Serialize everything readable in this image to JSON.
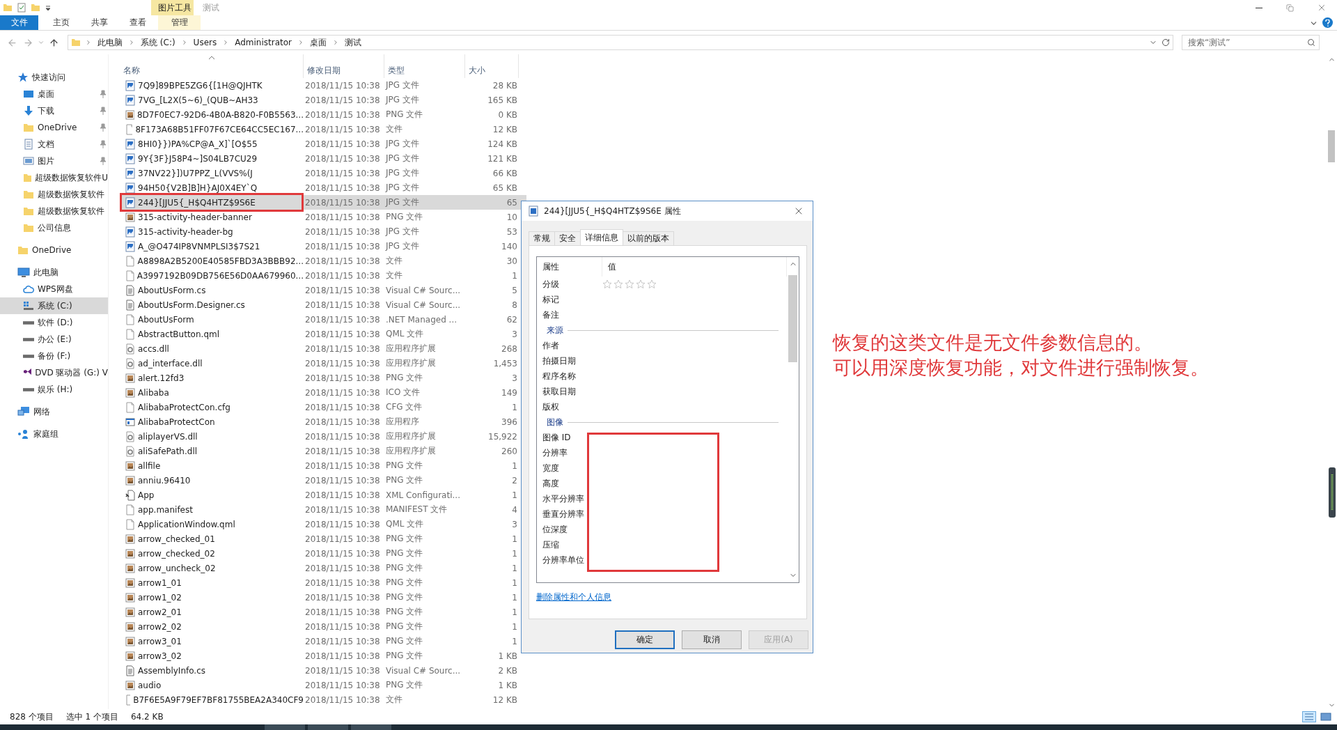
{
  "window": {
    "title": "测试",
    "context_header": "图片工具"
  },
  "ribbon_tabs": [
    {
      "label": "文件",
      "kind": "file"
    },
    {
      "label": "主页",
      "kind": "tab"
    },
    {
      "label": "共享",
      "kind": "tab"
    },
    {
      "label": "查看",
      "kind": "tab"
    },
    {
      "label": "管理",
      "kind": "context"
    }
  ],
  "address": {
    "crumbs": [
      "此电脑",
      "系统 (C:)",
      "Users",
      "Administrator",
      "桌面",
      "测试"
    ]
  },
  "search": {
    "placeholder": "搜索“测试”"
  },
  "sidebar": {
    "items": [
      {
        "label": "快速访问",
        "kind": "star",
        "selected": false,
        "pinned": false,
        "children": [
          {
            "label": "桌面",
            "kind": "desktop",
            "selected": false,
            "pinned": true
          },
          {
            "label": "下载",
            "kind": "download",
            "selected": false,
            "pinned": true
          },
          {
            "label": "OneDrive",
            "kind": "folder",
            "selected": false,
            "pinned": true
          },
          {
            "label": "文档",
            "kind": "document",
            "selected": false,
            "pinned": true
          },
          {
            "label": "图片",
            "kind": "picture",
            "selected": false,
            "pinned": true
          },
          {
            "label": "超级数据恢复软件U",
            "kind": "folder",
            "selected": false,
            "pinned": false
          },
          {
            "label": "超级数据恢复软件",
            "kind": "folder",
            "selected": false,
            "pinned": false
          },
          {
            "label": "超级数据恢复软件",
            "kind": "folder",
            "selected": false,
            "pinned": false
          },
          {
            "label": "公司信息",
            "kind": "folder",
            "selected": false,
            "pinned": false
          }
        ]
      },
      {
        "label": "OneDrive",
        "kind": "folder",
        "selected": false,
        "pinned": false
      },
      {
        "label": "此电脑",
        "kind": "pc",
        "selected": false,
        "pinned": false,
        "children": [
          {
            "label": "WPS网盘",
            "kind": "cloud",
            "selected": false,
            "pinned": false
          },
          {
            "label": "系统 (C:)",
            "kind": "sysdrive",
            "selected": true,
            "pinned": false
          },
          {
            "label": "软件 (D:)",
            "kind": "drive",
            "selected": false,
            "pinned": false
          },
          {
            "label": "办公 (E:)",
            "kind": "drive",
            "selected": false,
            "pinned": false
          },
          {
            "label": "备份 (F:)",
            "kind": "drive",
            "selected": false,
            "pinned": false
          },
          {
            "label": "DVD 驱动器 (G:) V",
            "kind": "dvd",
            "selected": false,
            "pinned": false
          },
          {
            "label": "娱乐 (H:)",
            "kind": "drive",
            "selected": false,
            "pinned": false
          }
        ]
      },
      {
        "label": "网络",
        "kind": "network",
        "selected": false,
        "pinned": false
      },
      {
        "label": "家庭组",
        "kind": "homegroup",
        "selected": false,
        "pinned": false
      }
    ]
  },
  "file_list": {
    "columns": [
      {
        "label": "名称",
        "sorted": true
      },
      {
        "label": "修改日期",
        "sorted": false
      },
      {
        "label": "类型",
        "sorted": false
      },
      {
        "label": "大小",
        "sorted": false
      }
    ],
    "rows": [
      {
        "name": "7Q9]89BPE5ZG6{[1H@QJHTK",
        "date": "2018/11/15 10:38",
        "type": "JPG 文件",
        "size": "28 KB",
        "kind": "jpg",
        "selected": false
      },
      {
        "name": "7VG_[L2X(5~6)_(QUB~AH33",
        "date": "2018/11/15 10:38",
        "type": "JPG 文件",
        "size": "165 KB",
        "kind": "jpg",
        "selected": false
      },
      {
        "name": "8D7F0EC7-92D6-4B0A-B820-F0B5563...",
        "date": "2018/11/15 10:38",
        "type": "PNG 文件",
        "size": "0 KB",
        "kind": "png",
        "selected": false
      },
      {
        "name": "8F173A68B51FF07F67CE64CC5EC167...",
        "date": "2018/11/15 10:38",
        "type": "文件",
        "size": "12 KB",
        "kind": "file",
        "selected": false
      },
      {
        "name": "8HI0}})PA%CP@A_X]`[O$55",
        "date": "2018/11/15 10:38",
        "type": "JPG 文件",
        "size": "124 KB",
        "kind": "jpg",
        "selected": false
      },
      {
        "name": "9Y{3F}J58P4~]S04LB7CU29",
        "date": "2018/11/15 10:38",
        "type": "JPG 文件",
        "size": "121 KB",
        "kind": "jpg",
        "selected": false
      },
      {
        "name": "37NV22}])U7PPZ_L(VVS%(J",
        "date": "2018/11/15 10:38",
        "type": "JPG 文件",
        "size": "66 KB",
        "kind": "jpg",
        "selected": false
      },
      {
        "name": "94H50{V2B]B]H}AJ0X4EY`Q",
        "date": "2018/11/15 10:38",
        "type": "JPG 文件",
        "size": "65 KB",
        "kind": "jpg",
        "selected": false
      },
      {
        "name": "244}[JJU5{_H$Q4HTZ$9S6E",
        "date": "2018/11/15 10:38",
        "type": "JPG 文件",
        "size": "65",
        "kind": "jpg",
        "selected": true
      },
      {
        "name": "315-activity-header-banner",
        "date": "2018/11/15 10:38",
        "type": "PNG 文件",
        "size": "10",
        "kind": "png",
        "selected": false
      },
      {
        "name": "315-activity-header-bg",
        "date": "2018/11/15 10:38",
        "type": "JPG 文件",
        "size": "53",
        "kind": "jpg",
        "selected": false
      },
      {
        "name": "A_@O474IP8VNMPLSI3$7S21",
        "date": "2018/11/15 10:38",
        "type": "JPG 文件",
        "size": "140",
        "kind": "jpg",
        "selected": false
      },
      {
        "name": "A8898A2B5200E40585FBD3A3BBB92...",
        "date": "2018/11/15 10:38",
        "type": "文件",
        "size": "30",
        "kind": "file",
        "selected": false
      },
      {
        "name": "A3997192B09DB756E56D0AA679960...",
        "date": "2018/11/15 10:38",
        "type": "文件",
        "size": "1",
        "kind": "file",
        "selected": false
      },
      {
        "name": "AboutUsForm.cs",
        "date": "2018/11/15 10:38",
        "type": "Visual C# Sourc...",
        "size": "5",
        "kind": "code",
        "selected": false
      },
      {
        "name": "AboutUsForm.Designer.cs",
        "date": "2018/11/15 10:38",
        "type": "Visual C# Sourc...",
        "size": "8",
        "kind": "code",
        "selected": false
      },
      {
        "name": "AboutUsForm",
        "date": "2018/11/15 10:38",
        "type": ".NET Managed ...",
        "size": "62",
        "kind": "file",
        "selected": false
      },
      {
        "name": "AbstractButton.qml",
        "date": "2018/11/15 10:38",
        "type": "QML 文件",
        "size": "3",
        "kind": "file",
        "selected": false
      },
      {
        "name": "accs.dll",
        "date": "2018/11/15 10:38",
        "type": "应用程序扩展",
        "size": "268",
        "kind": "dll",
        "selected": false
      },
      {
        "name": "ad_interface.dll",
        "date": "2018/11/15 10:38",
        "type": "应用程序扩展",
        "size": "1,453",
        "kind": "dll",
        "selected": false
      },
      {
        "name": "alert.12fd3",
        "date": "2018/11/15 10:38",
        "type": "PNG 文件",
        "size": "3",
        "kind": "png",
        "selected": false
      },
      {
        "name": "Alibaba",
        "date": "2018/11/15 10:38",
        "type": "ICO 文件",
        "size": "149",
        "kind": "png",
        "selected": false
      },
      {
        "name": "AlibabaProtectCon.cfg",
        "date": "2018/11/15 10:38",
        "type": "CFG 文件",
        "size": "1",
        "kind": "file",
        "selected": false
      },
      {
        "name": "AlibabaProtectCon",
        "date": "2018/11/15 10:38",
        "type": "应用程序",
        "size": "396",
        "kind": "exe",
        "selected": false
      },
      {
        "name": "aliplayerVS.dll",
        "date": "2018/11/15 10:38",
        "type": "应用程序扩展",
        "size": "15,922",
        "kind": "dll",
        "selected": false
      },
      {
        "name": "aliSafePath.dll",
        "date": "2018/11/15 10:38",
        "type": "应用程序扩展",
        "size": "260",
        "kind": "dll",
        "selected": false
      },
      {
        "name": "allfile",
        "date": "2018/11/15 10:38",
        "type": "PNG 文件",
        "size": "1",
        "kind": "png",
        "selected": false
      },
      {
        "name": "anniu.96410",
        "date": "2018/11/15 10:38",
        "type": "PNG 文件",
        "size": "2",
        "kind": "png",
        "selected": false
      },
      {
        "name": "App",
        "date": "2018/11/15 10:38",
        "type": "XML Configurati...",
        "size": "1",
        "kind": "xml",
        "selected": false
      },
      {
        "name": "app.manifest",
        "date": "2018/11/15 10:38",
        "type": "MANIFEST 文件",
        "size": "4",
        "kind": "file",
        "selected": false
      },
      {
        "name": "ApplicationWindow.qml",
        "date": "2018/11/15 10:38",
        "type": "QML 文件",
        "size": "3",
        "kind": "file",
        "selected": false
      },
      {
        "name": "arrow_checked_01",
        "date": "2018/11/15 10:38",
        "type": "PNG 文件",
        "size": "1",
        "kind": "png",
        "selected": false
      },
      {
        "name": "arrow_checked_02",
        "date": "2018/11/15 10:38",
        "type": "PNG 文件",
        "size": "1",
        "kind": "png",
        "selected": false
      },
      {
        "name": "arrow_uncheck_02",
        "date": "2018/11/15 10:38",
        "type": "PNG 文件",
        "size": "1",
        "kind": "png",
        "selected": false
      },
      {
        "name": "arrow1_01",
        "date": "2018/11/15 10:38",
        "type": "PNG 文件",
        "size": "1",
        "kind": "png",
        "selected": false
      },
      {
        "name": "arrow1_02",
        "date": "2018/11/15 10:38",
        "type": "PNG 文件",
        "size": "1",
        "kind": "png",
        "selected": false
      },
      {
        "name": "arrow2_01",
        "date": "2018/11/15 10:38",
        "type": "PNG 文件",
        "size": "1",
        "kind": "png",
        "selected": false
      },
      {
        "name": "arrow2_02",
        "date": "2018/11/15 10:38",
        "type": "PNG 文件",
        "size": "1",
        "kind": "png",
        "selected": false
      },
      {
        "name": "arrow3_01",
        "date": "2018/11/15 10:38",
        "type": "PNG 文件",
        "size": "1",
        "kind": "png",
        "selected": false
      },
      {
        "name": "arrow3_02",
        "date": "2018/11/15 10:38",
        "type": "PNG 文件",
        "size": "1 KB",
        "kind": "png",
        "selected": false
      },
      {
        "name": "AssemblyInfo.cs",
        "date": "2018/11/15 10:38",
        "type": "Visual C# Sourc...",
        "size": "2 KB",
        "kind": "code",
        "selected": false
      },
      {
        "name": "audio",
        "date": "2018/11/15 10:38",
        "type": "PNG 文件",
        "size": "1 KB",
        "kind": "png",
        "selected": false
      },
      {
        "name": "B7F6E5A9F79EF7BF81755BEA2A340CF9",
        "date": "2018/11/15 10:38",
        "type": "文件",
        "size": "12 KB",
        "kind": "file",
        "selected": false
      }
    ]
  },
  "annotation": {
    "lines": [
      "恢复的这类文件是无文件参数信息的。",
      "可以用深度恢复功能，对文件进行强制恢复。"
    ]
  },
  "dialog": {
    "title": "244}[JJU5{_H$Q4HTZ$9S6E 属性",
    "tabs": [
      {
        "label": "常规",
        "selected": false
      },
      {
        "label": "安全",
        "selected": false
      },
      {
        "label": "详细信息",
        "selected": true
      },
      {
        "label": "以前的版本",
        "selected": false
      }
    ],
    "columns": [
      "属性",
      "值"
    ],
    "properties": [
      {
        "kind": "rating",
        "label": "分级",
        "stars": 0
      },
      {
        "kind": "property",
        "label": "标记"
      },
      {
        "kind": "property",
        "label": "备注"
      },
      {
        "kind": "group",
        "label": "来源"
      },
      {
        "kind": "property",
        "label": "作者"
      },
      {
        "kind": "property",
        "label": "拍摄日期"
      },
      {
        "kind": "property",
        "label": "程序名称"
      },
      {
        "kind": "property",
        "label": "获取日期"
      },
      {
        "kind": "property",
        "label": "版权"
      },
      {
        "kind": "group",
        "label": "图像"
      },
      {
        "kind": "property",
        "label": "图像 ID"
      },
      {
        "kind": "property",
        "label": "分辨率"
      },
      {
        "kind": "property",
        "label": "宽度"
      },
      {
        "kind": "property",
        "label": "高度"
      },
      {
        "kind": "property",
        "label": "水平分辨率"
      },
      {
        "kind": "property",
        "label": "垂直分辨率"
      },
      {
        "kind": "property",
        "label": "位深度"
      },
      {
        "kind": "property",
        "label": "压缩"
      },
      {
        "kind": "property",
        "label": "分辨率单位"
      }
    ],
    "link": "删除属性和个人信息",
    "buttons": [
      {
        "label": "确定",
        "default": true,
        "disabled": false
      },
      {
        "label": "取消",
        "default": false,
        "disabled": false
      },
      {
        "label": "应用(A)",
        "default": false,
        "disabled": true
      }
    ]
  },
  "status_bar": {
    "count": "828 个项目",
    "selection": "选中 1 个项目",
    "size": "64.2 KB"
  }
}
